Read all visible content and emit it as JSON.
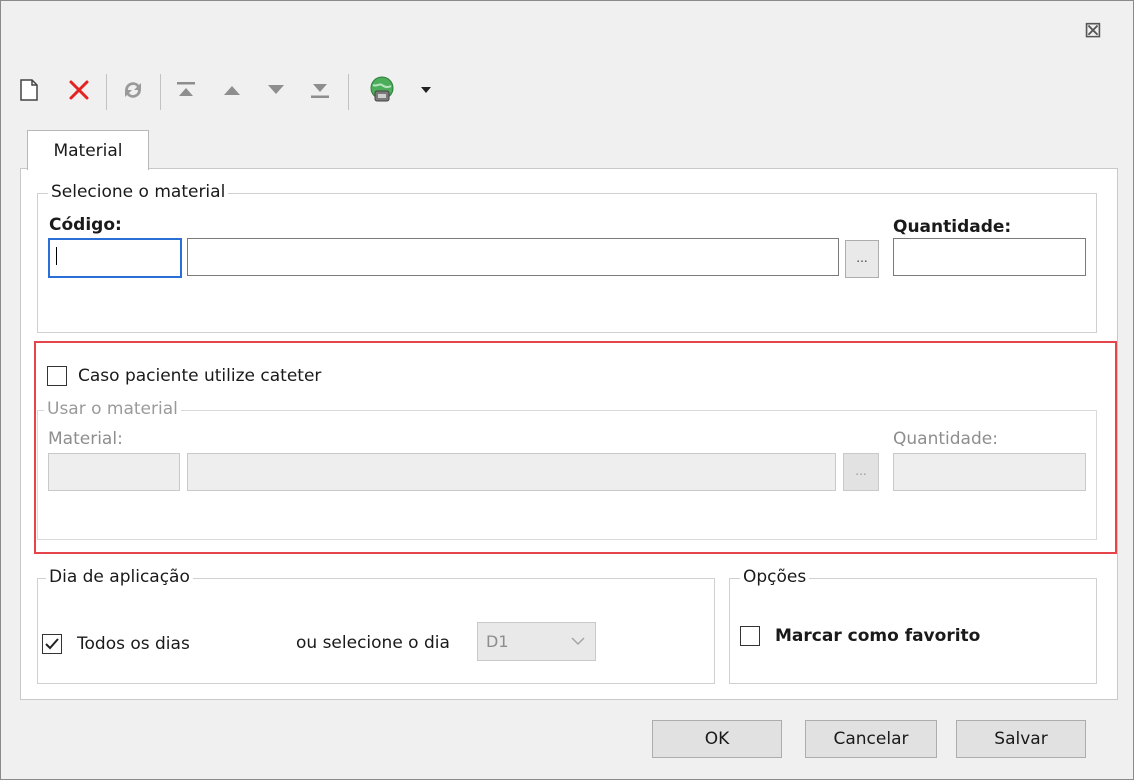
{
  "window": {
    "close_glyph": "⊠"
  },
  "toolbar": {
    "icons": [
      "new-document-icon",
      "delete-icon",
      "refresh-icon",
      "move-first-icon",
      "move-up-icon",
      "move-down-icon",
      "move-last-icon",
      "web-icon",
      "dropdown-arrow-icon"
    ],
    "colors": {
      "delete": "#e52222",
      "icon_gray": "#9a9a9a",
      "globe": "#2e8b57"
    }
  },
  "tabs": [
    {
      "label": "Material"
    }
  ],
  "select_material": {
    "legend": "Selecione o material",
    "code_label": "Código:",
    "code_value": "",
    "description_value": "",
    "lookup_label": "...",
    "quantity_label": "Quantidade:",
    "quantity_value": ""
  },
  "catheter": {
    "checkbox_label": "Caso paciente utilize cateter",
    "checked": false,
    "group_legend": "Usar o material",
    "material_label": "Material:",
    "lookup_label": "...",
    "quantity_label": "Quantidade:",
    "highlight_color": "#e4444a"
  },
  "application_day": {
    "legend": "Dia de aplicação",
    "all_days_label": "Todos os dias",
    "all_days_checked": true,
    "or_select_label": "ou selecione o dia",
    "day_value": "D1"
  },
  "options": {
    "legend": "Opções",
    "favorite_label": "Marcar como favorito",
    "favorite_checked": false
  },
  "buttons": {
    "ok": "OK",
    "cancel": "Cancelar",
    "save": "Salvar"
  }
}
